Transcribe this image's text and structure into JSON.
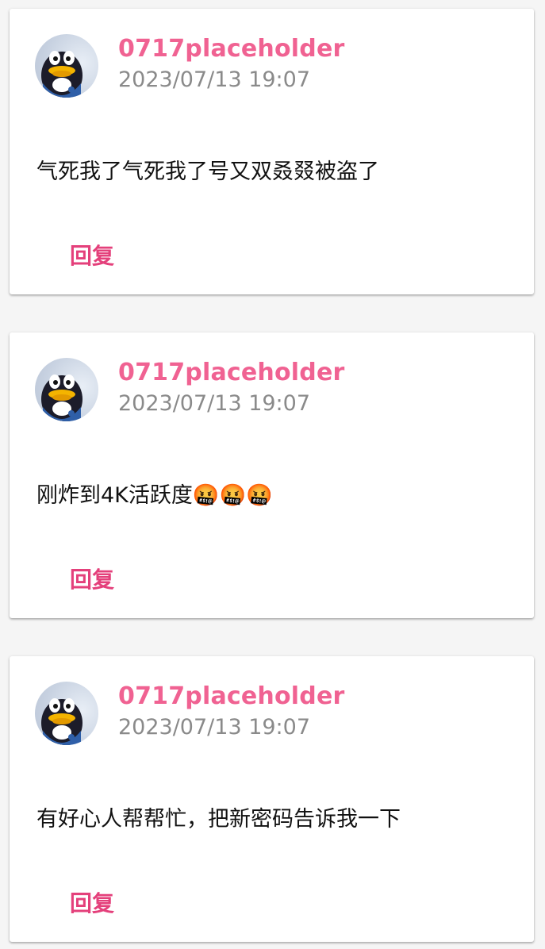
{
  "colors": {
    "username": "#f06292",
    "reply": "#e4407b",
    "timestamp": "#8a8a8a",
    "background": "#f5f5f5",
    "card": "#ffffff"
  },
  "posts": [
    {
      "avatar_icon": "qq-penguin-avatar",
      "username": "0717placeholder",
      "timestamp": "2023/07/13 19:07",
      "content": "气死我了气死我了号又双叒叕被盗了",
      "reply_label": "回复"
    },
    {
      "avatar_icon": "qq-penguin-avatar",
      "username": "0717placeholder",
      "timestamp": "2023/07/13 19:07",
      "content": "刚炸到4K活跃度🤬🤬🤬",
      "reply_label": "回复"
    },
    {
      "avatar_icon": "qq-penguin-avatar",
      "username": "0717placeholder",
      "timestamp": "2023/07/13 19:07",
      "content": "有好心人帮帮忙，把新密码告诉我一下",
      "reply_label": "回复"
    }
  ]
}
